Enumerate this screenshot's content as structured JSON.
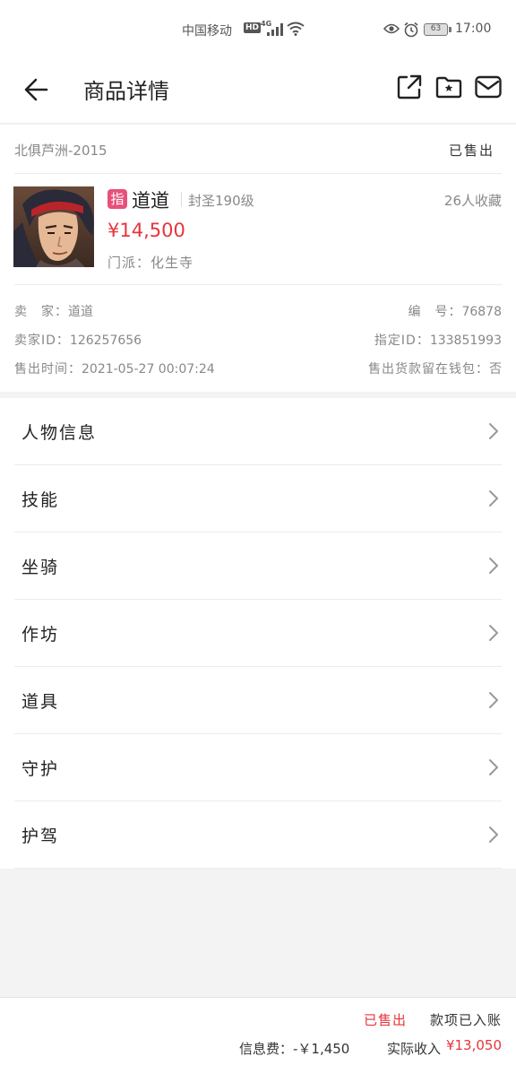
{
  "status_bar": {
    "carrier": "中国移动",
    "hd": "HD",
    "network": "4G",
    "battery": "63",
    "time": "17:00"
  },
  "header": {
    "title": "商品详情"
  },
  "product": {
    "server": "北俱芦洲-2015",
    "sold_tag": "已售出",
    "badge": "指",
    "name": "道道",
    "level": "封圣190级",
    "favorites": "26人收藏",
    "price": "¥14,500",
    "school": "门派：化生寺"
  },
  "info": {
    "seller_label": "卖　家：",
    "seller_value": "道道",
    "number_label": "编　号：",
    "number_value": "76878",
    "seller_id_label": "卖家ID：",
    "seller_id_value": "126257656",
    "designated_id_label": "指定ID：",
    "designated_id_value": "133851993",
    "sale_time_label": "售出时间：",
    "sale_time_value": "2021-05-27  00:07:24",
    "wallet_label": "售出货款留在钱包：",
    "wallet_value": "否"
  },
  "menu": {
    "items": [
      {
        "label": "人物信息"
      },
      {
        "label": "技能"
      },
      {
        "label": "坐骑"
      },
      {
        "label": "作坊"
      },
      {
        "label": "道具"
      },
      {
        "label": "守护"
      },
      {
        "label": "护驾"
      }
    ]
  },
  "footer": {
    "sold": "已售出",
    "status": "款项已入账",
    "fee": "信息费：-￥1,450",
    "income_label": "实际收入",
    "income_value": "¥13,050"
  },
  "colors": {
    "accent_red": "#e8343b",
    "badge_pink": "#e8507a",
    "background": "#f3f3f3"
  }
}
